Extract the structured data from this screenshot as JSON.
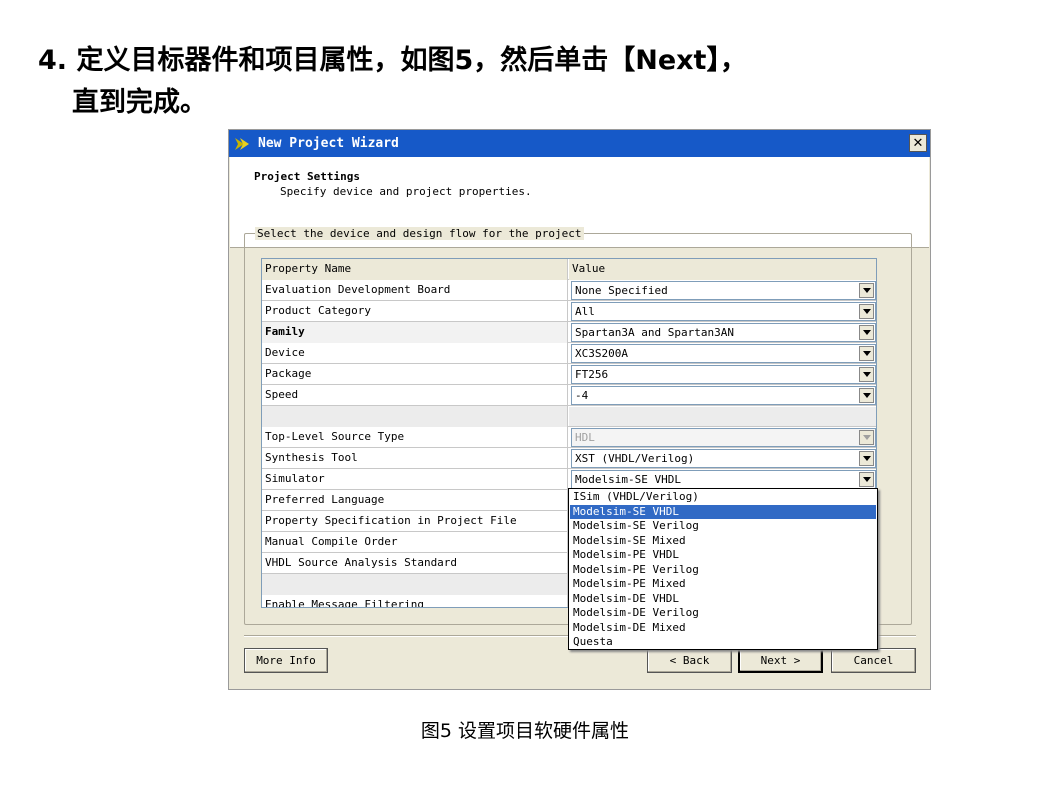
{
  "slide": {
    "heading_line1": "4. 定义目标器件和项目属性，如图5，然后单击【Next】，",
    "heading_line2": "直到完成。",
    "caption": "图5  设置项目软硬件属性"
  },
  "window": {
    "title": "New Project Wizard",
    "close_icon": "close-icon"
  },
  "header": {
    "title": "Project Settings",
    "subtitle": "Specify device and project properties."
  },
  "group": {
    "legend": "Select the device and design flow for the project"
  },
  "table": {
    "col_name": "Property Name",
    "col_value": "Value",
    "rows": [
      {
        "name": "Evaluation Development Board",
        "value": "None Specified"
      },
      {
        "name": "Product Category",
        "value": "All"
      },
      {
        "name": "Family",
        "value": "Spartan3A and Spartan3AN"
      },
      {
        "name": "Device",
        "value": "XC3S200A"
      },
      {
        "name": "Package",
        "value": "FT256"
      },
      {
        "name": "Speed",
        "value": "-4"
      },
      {
        "name": "",
        "value": ""
      },
      {
        "name": "Top-Level Source Type",
        "value": "HDL"
      },
      {
        "name": "Synthesis Tool",
        "value": "XST (VHDL/Verilog)"
      },
      {
        "name": "Simulator",
        "value": "Modelsim-SE VHDL"
      },
      {
        "name": "Preferred Language",
        "value": ""
      },
      {
        "name": "Property Specification in Project File",
        "value": ""
      },
      {
        "name": "Manual Compile Order",
        "value": ""
      },
      {
        "name": "VHDL Source Analysis Standard",
        "value": ""
      },
      {
        "name": "",
        "value": ""
      },
      {
        "name": "Enable Message Filtering",
        "value": ""
      }
    ]
  },
  "simulator_dropdown": {
    "options": [
      "ISim (VHDL/Verilog)",
      "Modelsim-SE VHDL",
      "Modelsim-SE Verilog",
      "Modelsim-SE Mixed",
      "Modelsim-PE VHDL",
      "Modelsim-PE Verilog",
      "Modelsim-PE Mixed",
      "Modelsim-DE VHDL",
      "Modelsim-DE Verilog",
      "Modelsim-DE Mixed",
      "Questa"
    ],
    "selected": "Modelsim-SE VHDL"
  },
  "buttons": {
    "more_info": "More Info",
    "back": "< Back",
    "next": "Next >",
    "cancel": "Cancel"
  },
  "colors": {
    "titlebar": "#1659c8",
    "selection": "#316ac5",
    "dialog_bg": "#ece9d8"
  }
}
